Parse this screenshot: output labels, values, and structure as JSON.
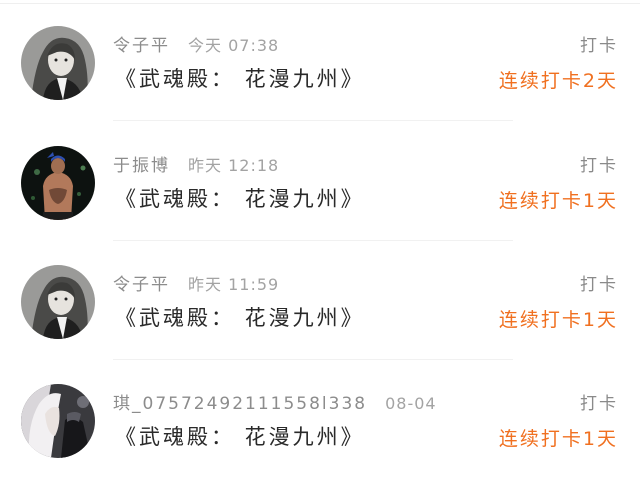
{
  "entries": [
    {
      "username": "令子平",
      "time": "今天 07:38",
      "book_title": "《武魂殿： 花漫九州》",
      "action_label": "打卡",
      "streak": "连续打卡2天",
      "avatar_icon": "anime-character-avatar"
    },
    {
      "username": "于振博",
      "time": "昨天 12:18",
      "book_title": "《武魂殿： 花漫九州》",
      "action_label": "打卡",
      "streak": "连续打卡1天",
      "avatar_icon": "tattooed-man-avatar"
    },
    {
      "username": "令子平",
      "time": "昨天 11:59",
      "book_title": "《武魂殿： 花漫九州》",
      "action_label": "打卡",
      "streak": "连续打卡1天",
      "avatar_icon": "anime-character-avatar"
    },
    {
      "username": "琪_07572492111558l338",
      "time": "08-04",
      "book_title": "《武魂殿： 花漫九州》",
      "action_label": "打卡",
      "streak": "连续打卡1天",
      "avatar_icon": "white-haired-anime-avatar"
    }
  ],
  "colors": {
    "streak": "#f07020",
    "username": "#8c8c8c",
    "title": "#2a2a2a",
    "divider": "#f1f1f1"
  }
}
